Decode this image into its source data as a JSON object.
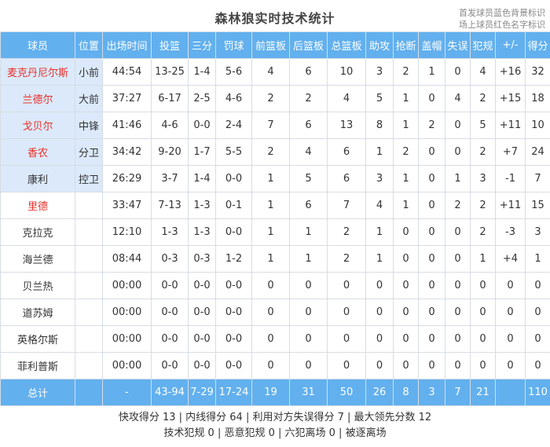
{
  "title": "森林狼实时技术统计",
  "legend": [
    "首发球员蓝色背景标识",
    "场上球员红色名字标识"
  ],
  "headers": [
    "球员",
    "位置",
    "出场时间",
    "投篮",
    "三分",
    "罚球",
    "前篮板",
    "后篮板",
    "总篮板",
    "助攻",
    "抢断",
    "盖帽",
    "失误",
    "犯规",
    "+/-",
    "得分"
  ],
  "players": [
    {
      "name": "麦克丹尼尔斯",
      "pos": "小前",
      "min": "44:54",
      "fg": "13-25",
      "tp": "1-4",
      "ft": "5-6",
      "oreb": "4",
      "dreb": "6",
      "reb": "10",
      "ast": "3",
      "stl": "2",
      "blk": "1",
      "tov": "0",
      "pf": "4",
      "pm": "+16",
      "pts": "32",
      "starter": true,
      "oncourt": true
    },
    {
      "name": "兰德尔",
      "pos": "大前",
      "min": "37:27",
      "fg": "6-17",
      "tp": "2-5",
      "ft": "4-6",
      "oreb": "2",
      "dreb": "2",
      "reb": "4",
      "ast": "5",
      "stl": "1",
      "blk": "0",
      "tov": "4",
      "pf": "2",
      "pm": "+15",
      "pts": "18",
      "starter": true,
      "oncourt": true
    },
    {
      "name": "戈贝尔",
      "pos": "中锋",
      "min": "41:46",
      "fg": "4-6",
      "tp": "0-0",
      "ft": "2-4",
      "oreb": "7",
      "dreb": "6",
      "reb": "13",
      "ast": "8",
      "stl": "1",
      "blk": "2",
      "tov": "0",
      "pf": "5",
      "pm": "+11",
      "pts": "10",
      "starter": true,
      "oncourt": true
    },
    {
      "name": "香农",
      "pos": "分卫",
      "min": "34:42",
      "fg": "9-20",
      "tp": "1-7",
      "ft": "5-5",
      "oreb": "2",
      "dreb": "4",
      "reb": "6",
      "ast": "1",
      "stl": "2",
      "blk": "0",
      "tov": "0",
      "pf": "2",
      "pm": "+7",
      "pts": "24",
      "starter": true,
      "oncourt": true
    },
    {
      "name": "康利",
      "pos": "控卫",
      "min": "26:29",
      "fg": "3-7",
      "tp": "1-4",
      "ft": "0-0",
      "oreb": "1",
      "dreb": "5",
      "reb": "6",
      "ast": "3",
      "stl": "1",
      "blk": "0",
      "tov": "1",
      "pf": "3",
      "pm": "-1",
      "pts": "7",
      "starter": true,
      "oncourt": false
    },
    {
      "name": "里德",
      "pos": "",
      "min": "33:47",
      "fg": "7-13",
      "tp": "1-3",
      "ft": "0-1",
      "oreb": "1",
      "dreb": "6",
      "reb": "7",
      "ast": "4",
      "stl": "1",
      "blk": "0",
      "tov": "2",
      "pf": "2",
      "pm": "+11",
      "pts": "15",
      "starter": false,
      "oncourt": true
    },
    {
      "name": "克拉克",
      "pos": "",
      "min": "12:10",
      "fg": "1-3",
      "tp": "1-3",
      "ft": "0-0",
      "oreb": "1",
      "dreb": "1",
      "reb": "2",
      "ast": "1",
      "stl": "0",
      "blk": "0",
      "tov": "0",
      "pf": "2",
      "pm": "-3",
      "pts": "3",
      "starter": false,
      "oncourt": false
    },
    {
      "name": "海兰德",
      "pos": "",
      "min": "08:44",
      "fg": "0-3",
      "tp": "0-3",
      "ft": "1-2",
      "oreb": "1",
      "dreb": "1",
      "reb": "2",
      "ast": "1",
      "stl": "0",
      "blk": "0",
      "tov": "0",
      "pf": "1",
      "pm": "+4",
      "pts": "1",
      "starter": false,
      "oncourt": false
    },
    {
      "name": "贝兰热",
      "pos": "",
      "min": "00:00",
      "fg": "0-0",
      "tp": "0-0",
      "ft": "0-0",
      "oreb": "0",
      "dreb": "0",
      "reb": "0",
      "ast": "0",
      "stl": "0",
      "blk": "0",
      "tov": "0",
      "pf": "0",
      "pm": "0",
      "pts": "0",
      "starter": false,
      "oncourt": false
    },
    {
      "name": "道苏姆",
      "pos": "",
      "min": "00:00",
      "fg": "0-0",
      "tp": "0-0",
      "ft": "0-0",
      "oreb": "0",
      "dreb": "0",
      "reb": "0",
      "ast": "0",
      "stl": "0",
      "blk": "0",
      "tov": "0",
      "pf": "0",
      "pm": "0",
      "pts": "0",
      "starter": false,
      "oncourt": false
    },
    {
      "name": "英格尔斯",
      "pos": "",
      "min": "00:00",
      "fg": "0-0",
      "tp": "0-0",
      "ft": "0-0",
      "oreb": "0",
      "dreb": "0",
      "reb": "0",
      "ast": "0",
      "stl": "0",
      "blk": "0",
      "tov": "0",
      "pf": "0",
      "pm": "0",
      "pts": "0",
      "starter": false,
      "oncourt": false
    },
    {
      "name": "菲利普斯",
      "pos": "",
      "min": "00:00",
      "fg": "0-0",
      "tp": "0-0",
      "ft": "0-0",
      "oreb": "0",
      "dreb": "0",
      "reb": "0",
      "ast": "0",
      "stl": "0",
      "blk": "0",
      "tov": "0",
      "pf": "0",
      "pm": "0",
      "pts": "0",
      "starter": false,
      "oncourt": false
    }
  ],
  "totals": {
    "label": "总计",
    "pos": "",
    "min": "-",
    "fg": "43-94",
    "tp": "7-29",
    "ft": "17-24",
    "oreb": "19",
    "dreb": "31",
    "reb": "50",
    "ast": "26",
    "stl": "8",
    "blk": "3",
    "tov": "7",
    "pf": "21",
    "pm": "",
    "pts": "110"
  },
  "footer": {
    "line1": "快攻得分 13 | 内线得分 64 | 利用对方失误得分 7 | 最大领先分数 12",
    "line2": "技术犯规 0 | 恶意犯规 0 | 六犯离场 0 | 被逐离场"
  },
  "colors": {
    "header_bg": "#62b0ee",
    "starter_bg": "#dbe9fa",
    "oncourt_text": "#e8322c",
    "border": "#d7dde5"
  }
}
